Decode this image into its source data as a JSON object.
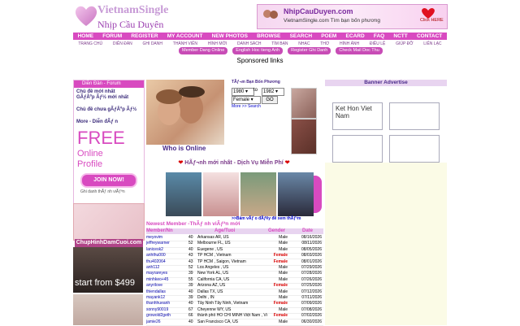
{
  "logo": {
    "line1": "VietnamSingle",
    "line2": "Nhịp Cầu Duyên"
  },
  "top_ad": {
    "domain": "NhipCauDuyen.com",
    "sub": "VietnamSingle.com Tìm bạn bốn phương",
    "cta": "Click HERE"
  },
  "nav": [
    "HOME",
    "FORUM",
    "REGISTER",
    "MY ACCOUNT",
    "NEW PHOTOS",
    "BROWSE",
    "SEARCH",
    "POEM",
    "ECARD",
    "FAQ",
    "NCTT",
    "CONTACT"
  ],
  "subnav": [
    "TRANG CHỦ",
    "DIỄN ĐÀN",
    "GHI DANH",
    "THÀNH VIÊN",
    "HÌNH MỚI",
    "DANH SÁCH",
    "TÌM BẠN",
    "NHẠC",
    "THƠ",
    "HÌNH ẢNH",
    "ĐIỀU LỆ",
    "GIÚP ĐỠ",
    "LIÊN LẠC"
  ],
  "pills": [
    "Member Dang Online",
    "English Hoc tieng Anh",
    "Register Ghi Danh",
    "Check Mail Doc Thu"
  ],
  "sponsored": "Sponsored links",
  "left": {
    "header": "Diễn Đàn - Forum",
    "items": [
      "Chủ đề mới nhất",
      "GÃƒÂºp Ãƒ½ mới nhất",
      "Chủ đề chưa gÃƒÂºp Ãƒ½",
      "More - Diễn đÃƒ n"
    ],
    "free": "FREE",
    "online_profile": "Online Profile",
    "join": "JOIN NOW!",
    "join_sub": "Ghi danh thÃƒ nh viÃƒªn",
    "wed_text": "ChupHinhDamCuoi.com",
    "start": "start from $499"
  },
  "who_online": "Who is Online",
  "search": {
    "title": "TÃƒ¬m Bạn Bốn Phương",
    "from": "1980",
    "to": "1982",
    "to_label": "to",
    "gender": "Female",
    "go": "GO",
    "more": "More >> Search"
  },
  "banner_ad": "Banner Advertise",
  "ad1": "Ket Hon Viet Nam",
  "newest_title": "HÃƒ¬nh mới nhất - Dịch Vụ Miễn Phí",
  "see_all": ">>Bấm vÃƒ o đÃƒ¢y để xem thÃƒªm",
  "newest_member": "Newest Member -ThÃƒ nh viÃƒªn mới",
  "table": {
    "headers": [
      "Member/Nn",
      "Age/Tuoi",
      "Gender",
      "Date"
    ],
    "rows": [
      [
        "meyovim",
        "40",
        "Arkansas AR, US",
        "Male",
        "08/16/2026"
      ],
      [
        "jeffreywarner",
        "52",
        "Melbourne FL, US",
        "Male",
        "08/11/2026"
      ],
      [
        "lanicesk2",
        "40",
        "Euegene , US",
        "Male",
        "08/05/2026"
      ],
      [
        "anhthu000",
        "43",
        "TP HCM , Vietnam",
        "Female",
        "08/03/2026"
      ],
      [
        "thu402064",
        "43",
        "TP HCM , Saigon, Vietnam",
        "Female",
        "08/01/2026"
      ],
      [
        "anh112",
        "52",
        "Los Angeles , US",
        "Male",
        "07/29/2026"
      ],
      [
        "mayrareyes",
        "39",
        "New York AL, US",
        "Male",
        "07/28/2026"
      ],
      [
        "minhkeo+45",
        "55",
        "California CA, US",
        "Male",
        "07/26/2026"
      ],
      [
        "anyrilove",
        "39",
        "Arizona AZ, US",
        "Female",
        "07/25/2026"
      ],
      [
        "thiendallas",
        "40",
        "Dallas TX, US",
        "Male",
        "07/12/2026"
      ],
      [
        "mayank12",
        "39",
        "Delhi , IN",
        "Male",
        "07/11/2026"
      ],
      [
        "thanhhueanh",
        "40",
        "Tây Ninh Tây Ninh, Vietnam",
        "Female",
        "07/09/2026"
      ],
      [
        "sonny90019",
        "67",
        "Cheyenne WY, US",
        "Male",
        "07/08/2026"
      ],
      [
        "growold2geth",
        "66",
        "thành phố HỒ CHÍ MINH Việt Nam , Vietnam",
        "Female",
        "07/02/2026"
      ],
      [
        "jamie26",
        "40",
        "San Francisco CA, US",
        "Male",
        "06/30/2026"
      ]
    ]
  },
  "colors": {
    "accent": "#d84ac0",
    "nav_bg": "#d84ac0",
    "title_purple": "#4a2a8a",
    "female": "#d80000"
  }
}
